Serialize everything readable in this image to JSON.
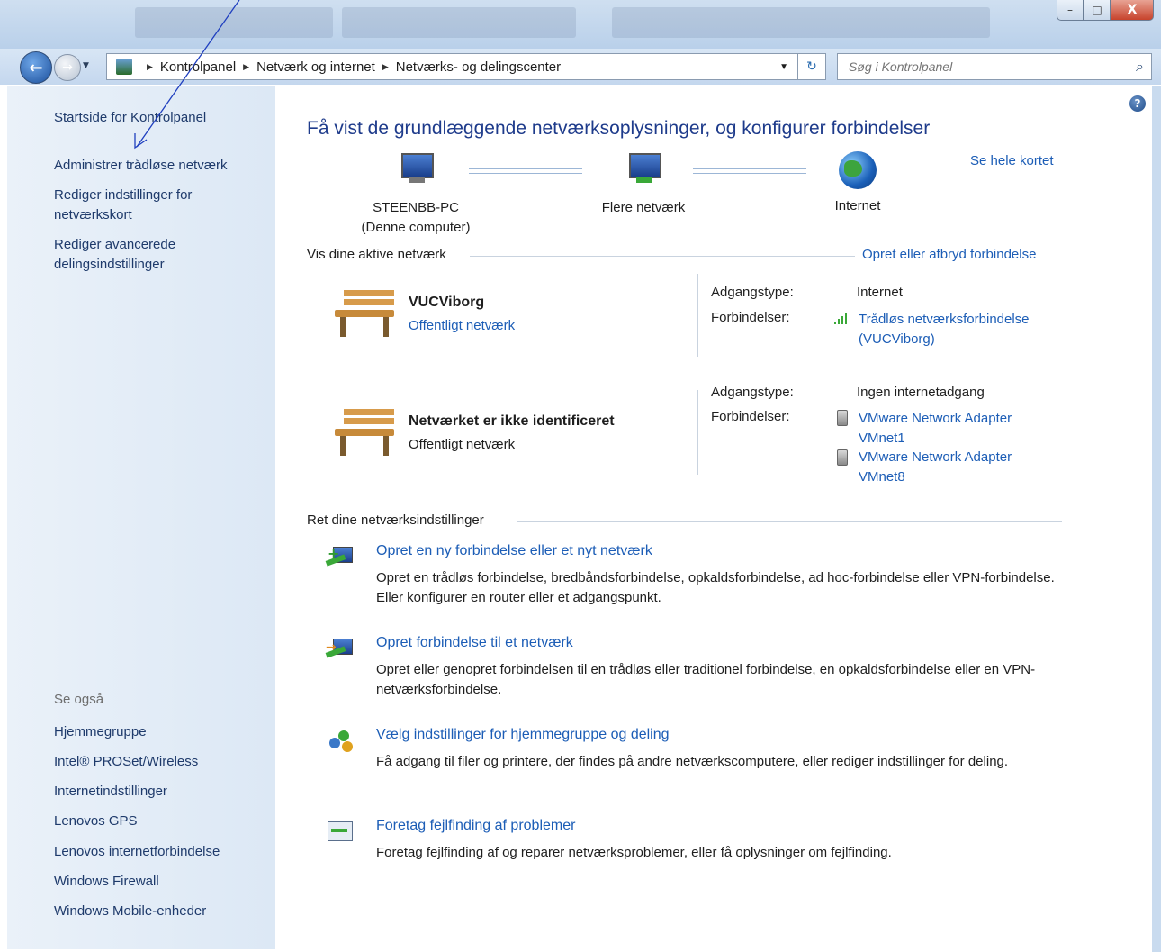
{
  "window": {
    "minimize": "–",
    "maximize": "□",
    "close": "X"
  },
  "nav": {
    "back": "←",
    "forward": "→",
    "breadcrumb": [
      "Kontrolpanel",
      "Netværk og internet",
      "Netværks- og delingscenter"
    ],
    "search_placeholder": "Søg i Kontrolpanel"
  },
  "sidebar": {
    "home": "Startside for Kontrolpanel",
    "links": [
      "Administrer trådløse netværk",
      "Rediger indstillinger for netværkskort",
      "Rediger avancerede delingsindstillinger"
    ],
    "see_also_title": "Se også",
    "see_also": [
      "Hjemmegruppe",
      "Intel® PROSet/Wireless",
      "Internetindstillinger",
      "Lenovos GPS",
      "Lenovos internetforbindelse",
      "Windows Firewall",
      "Windows Mobile-enheder"
    ]
  },
  "main": {
    "heading": "Få vist de grundlæggende netværksoplysninger, og konfigurer forbindelser",
    "map_link": "Se hele kortet",
    "map_nodes": [
      "STEENBB-PC",
      "(Denne computer)",
      "Flere netværk",
      "Internet"
    ],
    "active_title": "Vis dine aktive netværk",
    "connect_link": "Opret eller afbryd forbindelse",
    "networks": [
      {
        "name": "VUCViborg",
        "category": "Offentligt netværk",
        "access_label": "Adgangstype:",
        "access_value": "Internet",
        "conn_label": "Forbindelser:",
        "connections": [
          "Trådløs netværksforbindelse",
          "(VUCViborg)"
        ]
      },
      {
        "name": "Netværket er ikke identificeret",
        "category": "Offentligt netværk",
        "access_label": "Adgangstype:",
        "access_value": "Ingen internetadgang",
        "conn_label": "Forbindelser:",
        "connections": [
          "VMware Network Adapter",
          "VMnet1",
          "VMware Network Adapter",
          "VMnet8"
        ]
      }
    ],
    "settings_title": "Ret dine netværksindstillinger",
    "tasks": [
      {
        "title": "Opret en ny forbindelse eller et nyt netværk",
        "desc": "Opret en trådløs forbindelse, bredbåndsforbindelse, opkaldsforbindelse, ad hoc-forbindelse eller VPN-forbindelse. Eller konfigurer en router eller et adgangspunkt."
      },
      {
        "title": "Opret forbindelse til et netværk",
        "desc": "Opret eller genopret forbindelsen til en trådløs eller traditionel forbindelse, en opkaldsforbindelse eller en VPN-netværksforbindelse."
      },
      {
        "title": "Vælg indstillinger for hjemmegruppe og deling",
        "desc": "Få adgang til filer og printere, der findes på andre netværkscomputere, eller rediger indstillinger for deling."
      },
      {
        "title": "Foretag fejlfinding af problemer",
        "desc": "Foretag fejlfinding af og reparer netværksproblemer, eller få oplysninger om fejlfinding."
      }
    ]
  }
}
